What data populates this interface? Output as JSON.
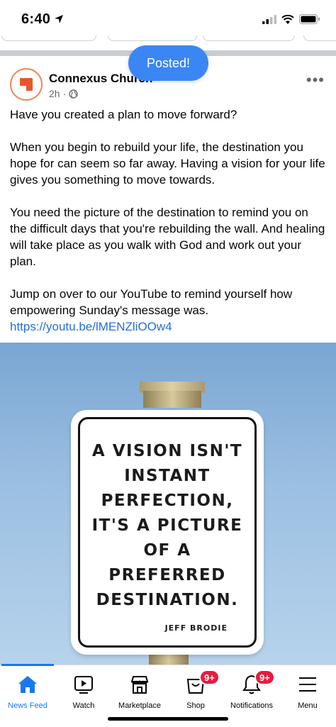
{
  "status_bar": {
    "time": "6:40"
  },
  "toast": {
    "label": "Posted!"
  },
  "post": {
    "author": "Connexus Church",
    "time": "2h",
    "paragraphs": [
      "Have you created a plan to move forward?",
      "When you begin to rebuild your life, the destination you hope for can seem so far away. Having a vision for your life gives you something to move towards.",
      "You need the picture of the destination to remind you on the difficult days that you're rebuilding the wall. And healing will take place as you walk with God and work out your plan."
    ],
    "last_paragraph_text": "Jump on over to our YouTube to remind yourself how empowering Sunday's message was. ",
    "link": "https://youtu.be/lMENZliOOw4"
  },
  "image": {
    "sign_text_lines": [
      "A VISION ISN'T",
      "INSTANT",
      "PERFECTION,",
      "IT'S A PICTURE",
      "OF A",
      "PREFERRED",
      "DESTINATION."
    ],
    "sign_author": "JEFF BRODIE"
  },
  "tabs": [
    {
      "label": "News Feed",
      "icon": "home-icon",
      "active": true
    },
    {
      "label": "Watch",
      "icon": "watch-icon"
    },
    {
      "label": "Marketplace",
      "icon": "marketplace-icon"
    },
    {
      "label": "Shop",
      "icon": "shop-icon",
      "badge": "9+"
    },
    {
      "label": "Notifications",
      "icon": "bell-icon",
      "badge": "9+"
    },
    {
      "label": "Menu",
      "icon": "menu-icon"
    }
  ],
  "colors": {
    "accent": "#1877f2",
    "badge": "#e41e3f",
    "toast": "#3b86f5",
    "link": "#216fdb"
  }
}
